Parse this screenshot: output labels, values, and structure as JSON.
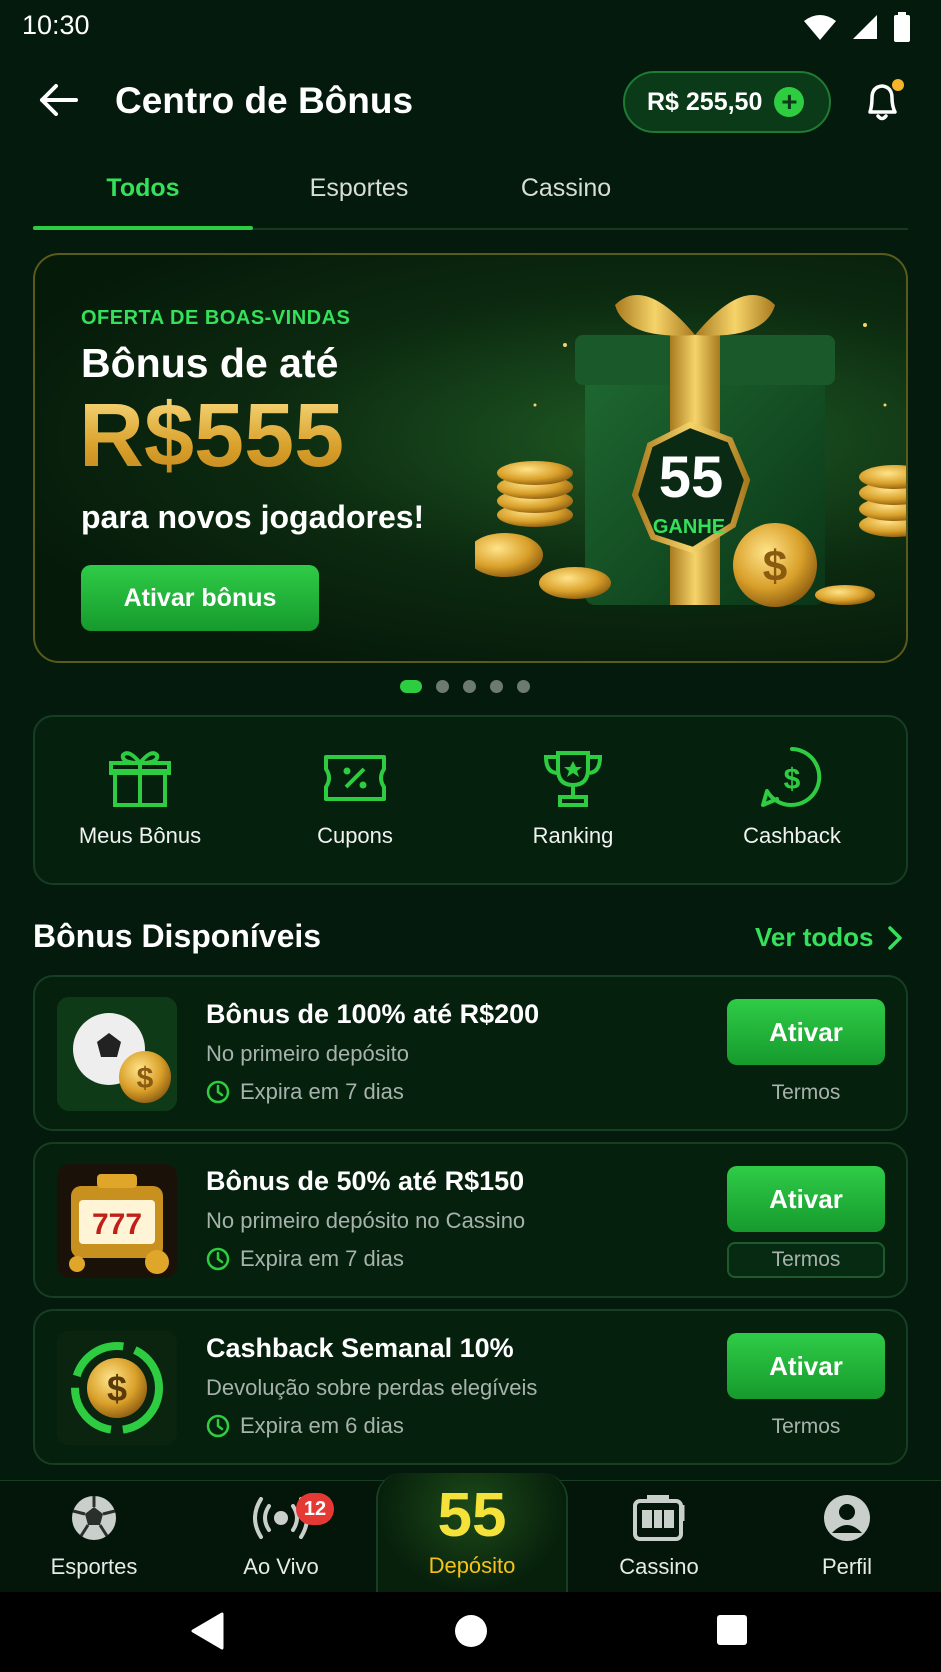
{
  "status_bar": {
    "time": "10:30"
  },
  "header": {
    "title": "Centro de Bônus",
    "balance": "R$ 255,50"
  },
  "tabs": [
    {
      "label": "Todos",
      "active": true
    },
    {
      "label": "Esportes",
      "active": false
    },
    {
      "label": "Cassino",
      "active": false
    }
  ],
  "banner": {
    "eyebrow": "OFERTA DE BOAS-VINDAS",
    "line1": "Bônus de até",
    "amount": "R$555",
    "line2": "para novos jogadores!",
    "button_label": "Ativar bônus",
    "badge_number": "55",
    "badge_text": "GANHE",
    "coin_symbol": "$"
  },
  "carousel": {
    "count": 5,
    "active_index": 0
  },
  "quick_actions": [
    {
      "label": "Meus Bônus",
      "icon": "gift-icon"
    },
    {
      "label": "Cupons",
      "icon": "coupon-icon"
    },
    {
      "label": "Ranking",
      "icon": "trophy-icon"
    },
    {
      "label": "Cashback",
      "icon": "cashback-icon"
    }
  ],
  "section": {
    "title": "Bônus Disponíveis",
    "see_all": "Ver todos"
  },
  "bonuses": [
    {
      "title": "Bônus de 100% até R$200",
      "subtitle": "No primeiro depósito",
      "expires": "Expira em 7 dias",
      "button": "Ativar",
      "terms": "Termos",
      "thumb": "soccer-coin"
    },
    {
      "title": "Bônus de 50% até R$150",
      "subtitle": "No primeiro depósito no Cassino",
      "expires": "Expira em 7 dias",
      "button": "Ativar",
      "terms": "Termos",
      "thumb": "slot-777",
      "slot_digits": "777"
    },
    {
      "title": "Cashback Semanal 10%",
      "subtitle": "Devolução sobre perdas elegíveis",
      "expires": "Expira em 6 dias",
      "button": "Ativar",
      "terms": "Termos",
      "thumb": "cashback-coin",
      "coin_symbol": "$"
    }
  ],
  "bottom_nav": [
    {
      "label": "Esportes",
      "icon": "soccer-ball-icon"
    },
    {
      "label": "Ao Vivo",
      "icon": "live-icon",
      "badge": "12"
    },
    {
      "label": "Depósito",
      "icon": "brand-55-logo",
      "logo_text": "55"
    },
    {
      "label": "Cassino",
      "icon": "slot-machine-icon"
    },
    {
      "label": "Perfil",
      "icon": "profile-icon"
    }
  ],
  "colors": {
    "background": "#041a0c",
    "accent_green": "#2ecc40",
    "gold": "#e8b434",
    "badge_red": "#e53935"
  }
}
